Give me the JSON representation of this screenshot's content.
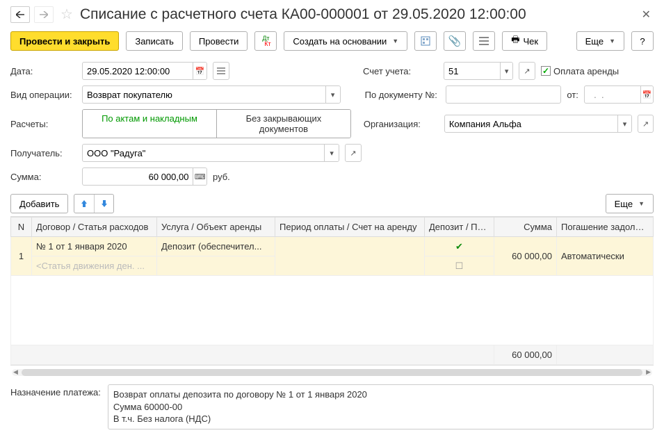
{
  "header": {
    "title": "Списание с расчетного счета КА00-000001 от 29.05.2020 12:00:00"
  },
  "toolbar": {
    "post_close": "Провести и закрыть",
    "save": "Записать",
    "post": "Провести",
    "create_based": "Создать на основании",
    "check": "Чек",
    "more": "Еще",
    "help": "?"
  },
  "fields": {
    "date_label": "Дата:",
    "date_value": "29.05.2020 12:00:00",
    "account_label": "Счет учета:",
    "account_value": "51",
    "rent_payment_label": "Оплата аренды",
    "operation_label": "Вид операции:",
    "operation_value": "Возврат покупателю",
    "doc_number_label": "По документу №:",
    "doc_number_value": "",
    "doc_date_label": "от:",
    "doc_date_value": "  .  .    ",
    "settlements_label": "Расчеты:",
    "settlements_opt1": "По актам и накладным",
    "settlements_opt2": "Без закрывающих документов",
    "org_label": "Организация:",
    "org_value": "Компания Альфа",
    "recipient_label": "Получатель:",
    "recipient_value": "ООО \"Радуга\"",
    "sum_label": "Сумма:",
    "sum_value": "60 000,00",
    "sum_currency": "руб."
  },
  "table": {
    "add": "Добавить",
    "more": "Еще",
    "cols": {
      "n": "N",
      "contract": "Договор / Статья расходов",
      "service": "Услуга / Объект аренды",
      "period": "Период оплаты / Счет на аренду",
      "deposit": "Депозит / Пени",
      "sum": "Сумма",
      "repay": "Погашение задолженно..."
    },
    "rows": [
      {
        "n": "1",
        "contract_top": "№ 1 от 1 января 2020",
        "contract_bottom_placeholder": "<Статья движения ден. ...",
        "service": "Депозит (обеспечител...",
        "period": "",
        "deposit_checked": true,
        "sum": "60 000,00",
        "repay": "Автоматически"
      }
    ],
    "totals": {
      "sum": "60 000,00"
    }
  },
  "bottom": {
    "purpose_label": "Назначение платежа:",
    "purpose_value": "Возврат оплаты депозита по договору № 1 от 1 января 2020\nСумма 60000-00\nВ т.ч. Без налога (НДС)"
  }
}
